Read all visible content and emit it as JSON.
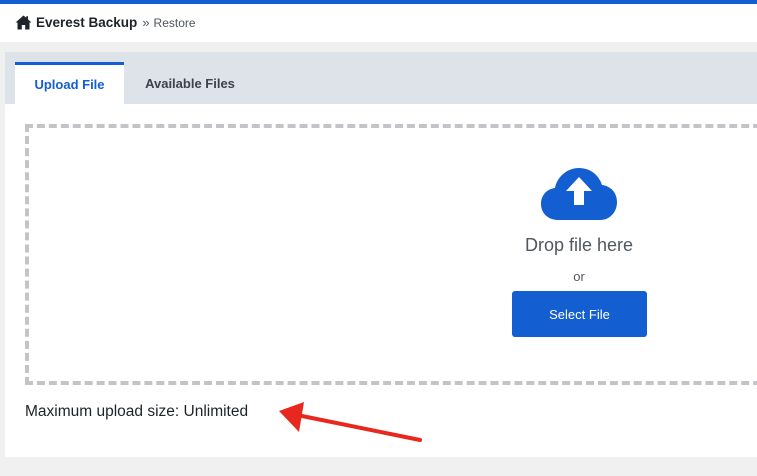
{
  "breadcrumb": {
    "home_icon": "home-icon",
    "brand": "Everest Backup",
    "separator": "»",
    "current": "Restore"
  },
  "tabs": [
    {
      "label": "Upload File",
      "active": true
    },
    {
      "label": "Available Files",
      "active": false
    }
  ],
  "dropzone": {
    "icon": "cloud-upload-icon",
    "drop_text": "Drop file here",
    "or_text": "or",
    "select_label": "Select File"
  },
  "upload_limit": {
    "text": "Maximum upload size: Unlimited"
  },
  "annotation": {
    "icon": "red-arrow-annotation"
  },
  "colors": {
    "accent": "#135ed1",
    "tabbar": "#dde3e9",
    "annotation": "#e8281e",
    "background": "#f0f0f1"
  }
}
